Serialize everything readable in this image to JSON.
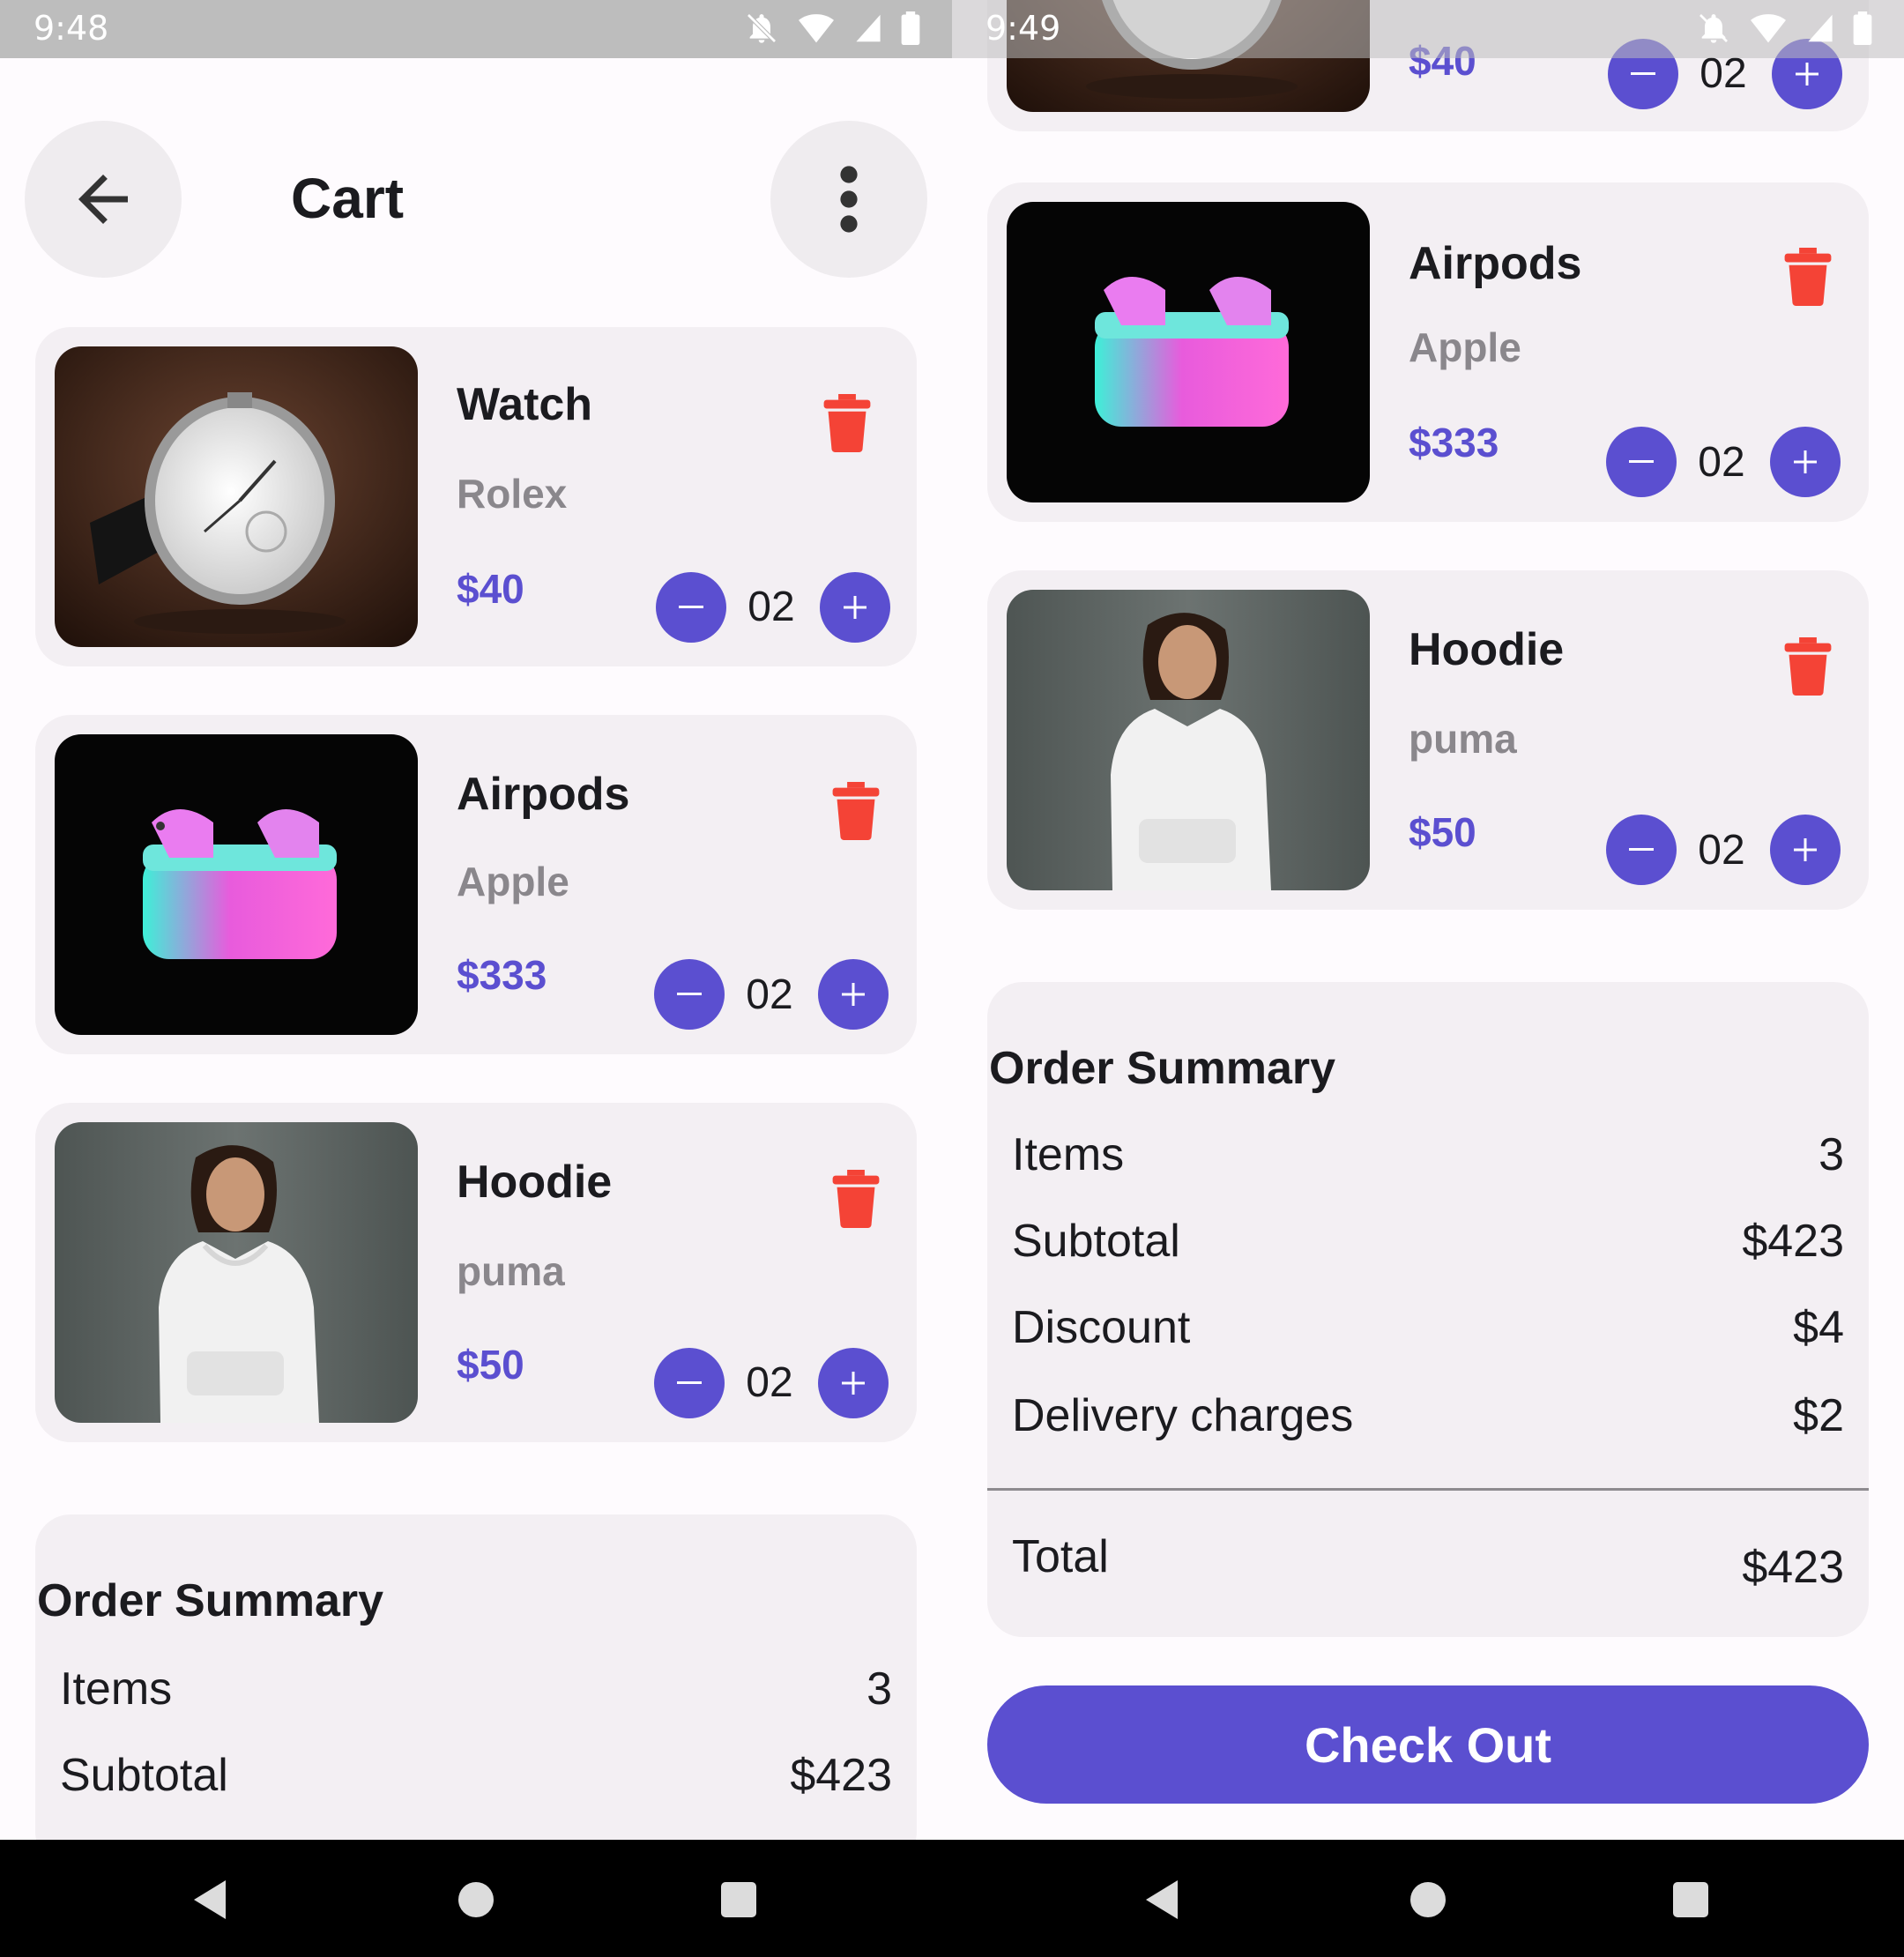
{
  "screens": {
    "left": {
      "status_time": "9:48"
    },
    "right": {
      "status_time": "9:49"
    }
  },
  "header": {
    "title": "Cart"
  },
  "cart_items": [
    {
      "name": "Watch",
      "brand": "Rolex",
      "price": "$40",
      "quantity": "02",
      "image": "wristwatch-photo"
    },
    {
      "name": "Airpods",
      "brand": "Apple",
      "price": "$333",
      "quantity": "02",
      "image": "airpods-case-photo"
    },
    {
      "name": "Hoodie",
      "brand": "puma",
      "price": "$50",
      "quantity": "02",
      "image": "woman-in-white-hoodie-photo"
    }
  ],
  "order_summary": {
    "title": "Order Summary",
    "rows": [
      {
        "label": "Items",
        "value": "3"
      },
      {
        "label": "Subtotal",
        "value": "$423"
      },
      {
        "label": "Discount",
        "value": "$4"
      },
      {
        "label": "Delivery charges",
        "value": "$2"
      }
    ],
    "total": {
      "label": "Total",
      "value": "$423"
    }
  },
  "checkout": {
    "label": "Check Out"
  },
  "icons": {
    "back": "arrow-left-icon",
    "menu": "more-vert-icon",
    "delete": "trash-icon",
    "decrease": "minus-icon",
    "increase": "plus-icon"
  },
  "colors": {
    "accent": "#5b4fd0",
    "delete": "#f44336",
    "card_bg": "#f3eff3",
    "muted_text": "#8a878c",
    "status_bar": "#bdbdbd"
  }
}
